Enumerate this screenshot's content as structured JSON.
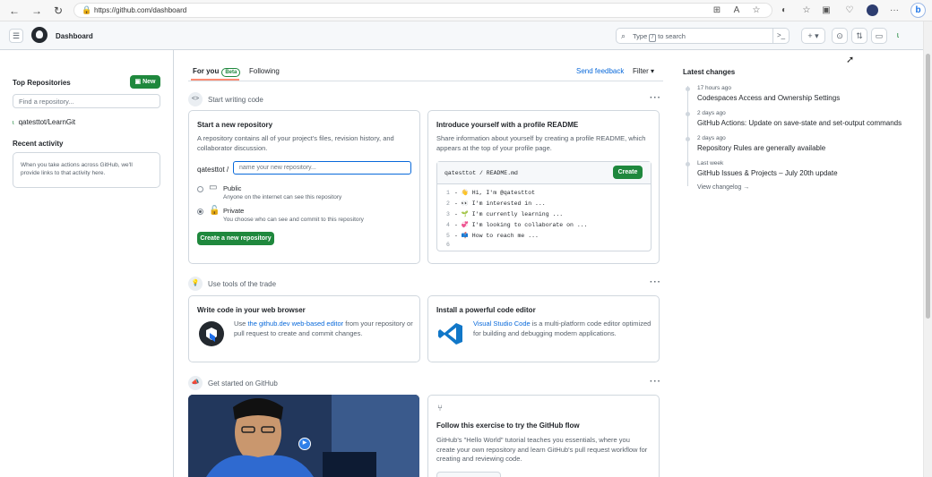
{
  "browser": {
    "url": "https://github.com/dashboard"
  },
  "header": {
    "title": "Dashboard",
    "search_text": "Type",
    "search_key": "/",
    "search_text_2": "to search"
  },
  "sidebar": {
    "top_repos_heading": "Top Repositories",
    "new_button": "New",
    "find_placeholder": "Find a repository...",
    "repo": "qatesttot/LearnGit",
    "recent_heading": "Recent activity",
    "recent_empty": "When you take actions across GitHub, we'll provide links to that activity here."
  },
  "feed": {
    "tab_for_you": "For you",
    "beta": "Beta",
    "tab_following": "Following",
    "send_feedback": "Send feedback",
    "filter": "Filter",
    "section_start": "Start writing code",
    "section_tools": "Use tools of the trade",
    "section_get_started": "Get started on GitHub"
  },
  "new_repo": {
    "title": "Start a new repository",
    "desc": "A repository contains all of your project's files, revision history, and collaborator discussion.",
    "owner": "qatesttot /",
    "name_placeholder": "name your new repository...",
    "public_label": "Public",
    "public_desc": "Anyone on the internet can see this repository",
    "private_label": "Private",
    "private_desc": "You choose who can see and commit to this repository",
    "create_button": "Create a new repository"
  },
  "readme": {
    "title": "Introduce yourself with a profile README",
    "desc": "Share information about yourself by creating a profile README, which appears at the top of your profile page.",
    "path": "qatesttot / README.md",
    "create_button": "Create",
    "lines": [
      {
        "n": "1",
        "text": "- 👋 Hi, I'm @qatesttot"
      },
      {
        "n": "2",
        "text": "- 👀 I'm interested in ..."
      },
      {
        "n": "3",
        "text": "- 🌱 I'm currently learning ..."
      },
      {
        "n": "4",
        "text": "- 💞️ I'm looking to collaborate on ..."
      },
      {
        "n": "5",
        "text": "- 📫 How to reach me ..."
      },
      {
        "n": "6",
        "text": ""
      }
    ]
  },
  "tools": {
    "browser_title": "Write code in your web browser",
    "browser_pre": "Use",
    "browser_link": "the github.dev web-based editor",
    "browser_post": "from your repository or pull request to create and commit changes.",
    "editor_title": "Install a powerful code editor",
    "editor_link": "Visual Studio Code",
    "editor_post": "is a multi-platform code editor optimized for building and debugging modern applications."
  },
  "get_started": {
    "flow_title": "Follow this exercise to try the GitHub flow",
    "flow_desc": "GitHub's \"Hello World\" tutorial teaches you essentials, where you create your own repository and learn GitHub's pull request workflow for creating and reviewing code."
  },
  "changes": {
    "heading": "Latest changes",
    "items": [
      {
        "date": "17 hours ago",
        "title": "Codespaces Access and Ownership Settings"
      },
      {
        "date": "2 days ago",
        "title": "GitHub Actions: Update on save-state and set-output commands"
      },
      {
        "date": "2 days ago",
        "title": "Repository Rules are generally available"
      },
      {
        "date": "Last week",
        "title": "GitHub Issues & Projects – July 20th update"
      }
    ],
    "view_changelog": "View changelog →"
  },
  "colors": {
    "primary_green": "#1f883d",
    "link_blue": "#0969da",
    "tab_accent": "#fd8c73"
  }
}
